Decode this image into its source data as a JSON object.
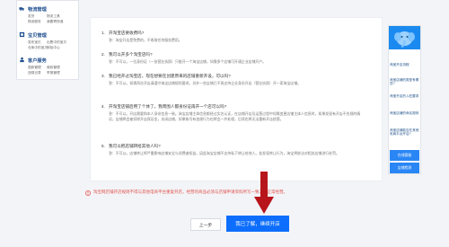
{
  "left_menu": [
    {
      "title": "物流管理",
      "icon": "truck-icon",
      "links": [
        "发货",
        "物流工具",
        "物流服务",
        "我要寄快递"
      ]
    },
    {
      "title": "宝贝管理",
      "icon": "item-icon",
      "links": [
        "发布宝贝",
        "出售中的宝贝",
        "仓库中的宝贝",
        "体检中心"
      ]
    },
    {
      "title": "客户服务",
      "icon": "customer-icon",
      "links": [
        "退款管理",
        "维权管理",
        "违规记录",
        "举报管理"
      ]
    }
  ],
  "faq": [
    {
      "num": "1.",
      "q": "开淘宝店要收费吗?",
      "a": "答：淘宝开店是免费的，不收取任何服务费用。"
    },
    {
      "num": "2.",
      "q": "我可以开多个淘宝店吗?",
      "a": "答：不可以。一位身份证（一张营业执照）只能开一个淘宝店铺，如需多个店铺可开通企业店铺开户。"
    },
    {
      "num": "3.",
      "q": "我已经开过淘宝店，现在想要在创建原来的店铺重新开设，可以吗?",
      "a": "答：不可以。如需再次开店请遵守淘宝店铺规则要求。另外一些店铺已不再支持企业身份开店（营业执照）开一家淘宝店铺。"
    },
    {
      "num": "4.",
      "q": "开淘宝店铺后用了个体了，我周围人都身份证再开一个店可以吗?",
      "a": "答：不可以。开店需要和本人身份信息一致。淘宝店铺主体信息都经过实名认证，在店铺开店及运营过程中如需变更店铺主体人信息时，如果发现有开店不合规的情况，店铺将会被扣除开店保证金，关闭店铺，如果账号有违规行为也将会一并处理，后续也将无法重新开店经营。"
    },
    {
      "num": "5.",
      "q": "我可以把店铺转给其他人吗?",
      "a": "答：不可以。店铺转让将严重影响店铺安全与消费者权益，因此淘宝店铺不支持私下转让给他人。若发现转让行为，淘宝将依法对相关店铺进行处罚。"
    }
  ],
  "notice": "淘宝网店铺开店规则不得与其他电商平台重复开店，经营的商品必须与店铺申请资料所写一致方可正常经营。",
  "buttons": {
    "prev": "上一步",
    "next": "我已了解，继续开店"
  },
  "right_panel": {
    "links": [
      "淘宝开店流程",
      "淘宝店铺的类型有哪些?",
      "淘宝开店的入驻要求",
      "淘宝店铺的命名规则",
      "淘宝店铺能否在其他电商平台开店?"
    ],
    "buttons": [
      "在线客服",
      "店铺检测"
    ]
  },
  "colors": {
    "brand_blue": "#1b8af0",
    "primary_button": "#0d6efd",
    "notice_red": "#e0514d",
    "arrow": "#b8141b"
  }
}
